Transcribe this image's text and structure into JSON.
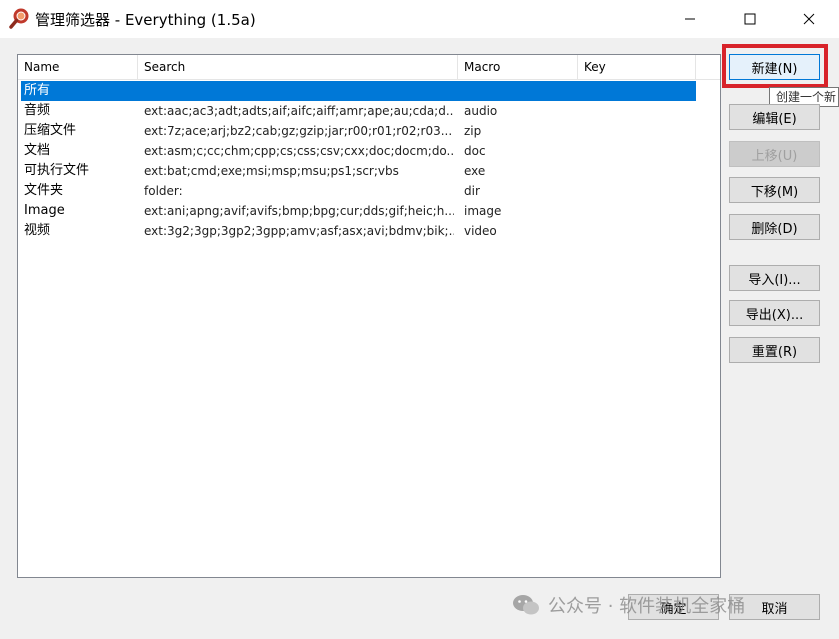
{
  "window": {
    "title": "管理筛选器 - Everything (1.5a)",
    "icon": "magnifier-icon"
  },
  "list": {
    "columns": [
      "Name",
      "Search",
      "Macro",
      "Key"
    ],
    "rows": [
      {
        "name": "所有",
        "search": "",
        "macro": "",
        "selected": true
      },
      {
        "name": "音频",
        "search": "ext:aac;ac3;adt;adts;aif;aifc;aiff;amr;ape;au;cda;d...",
        "macro": "audio"
      },
      {
        "name": "压缩文件",
        "search": "ext:7z;ace;arj;bz2;cab;gz;gzip;jar;r00;r01;r02;r03...",
        "macro": "zip"
      },
      {
        "name": "文档",
        "search": "ext:asm;c;cc;chm;cpp;cs;css;csv;cxx;doc;docm;do...",
        "macro": "doc"
      },
      {
        "name": "可执行文件",
        "search": "ext:bat;cmd;exe;msi;msp;msu;ps1;scr;vbs",
        "macro": "exe"
      },
      {
        "name": "文件夹",
        "search": "folder:",
        "macro": "dir"
      },
      {
        "name": "Image",
        "search": "ext:ani;apng;avif;avifs;bmp;bpg;cur;dds;gif;heic;h...",
        "macro": "image"
      },
      {
        "name": "视频",
        "search": "ext:3g2;3gp;3gp2;3gpp;amv;asf;asx;avi;bdmv;bik;...",
        "macro": "video"
      }
    ]
  },
  "buttons": {
    "new": "新建(N)",
    "edit": "编辑(E)",
    "up": "上移(U)",
    "down": "下移(M)",
    "delete": "删除(D)",
    "import": "导入(I)...",
    "export": "导出(X)...",
    "reset": "重置(R)",
    "ok": "确定",
    "cancel": "取消"
  },
  "tooltip": "创建一个新",
  "watermark": "公众号 · 软件装机全家桶",
  "colors": {
    "selection": "#0078d7",
    "highlight_box": "#d8232a"
  }
}
